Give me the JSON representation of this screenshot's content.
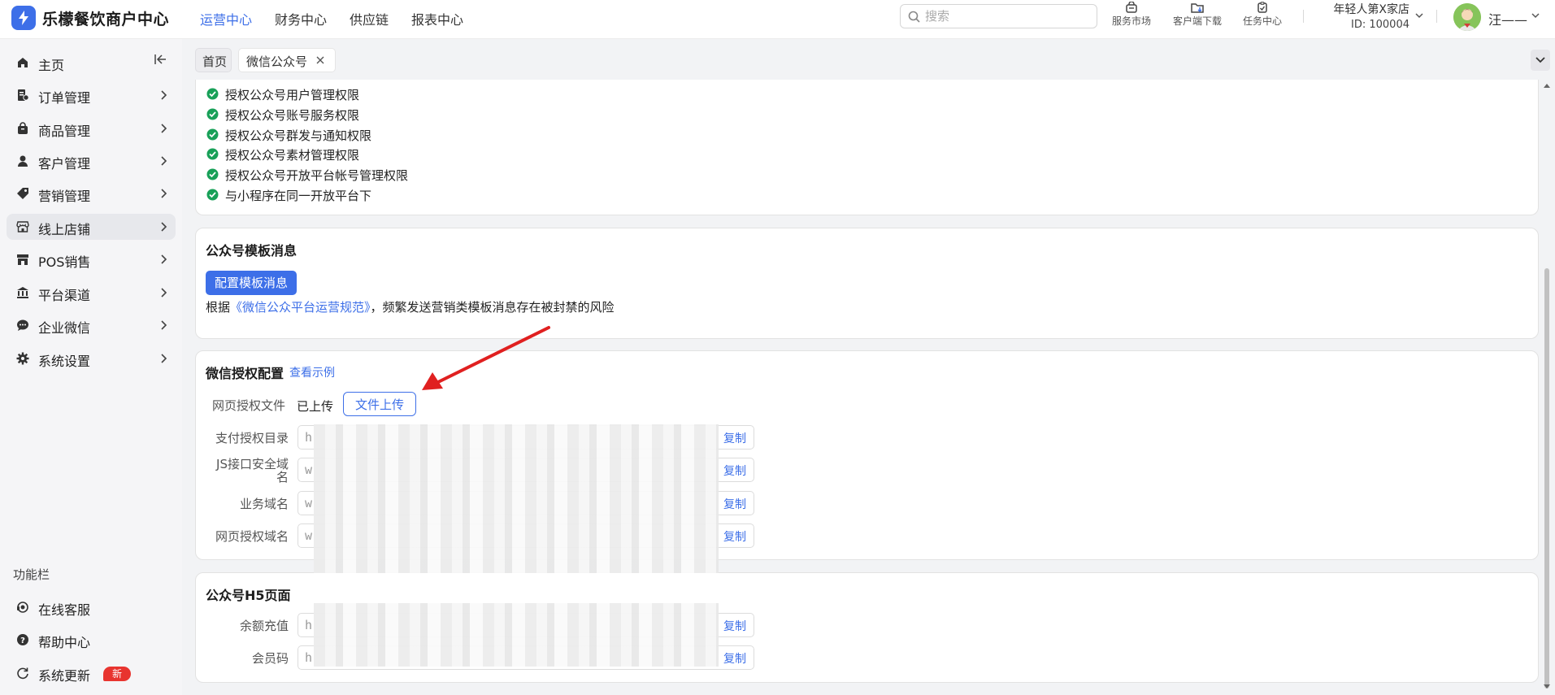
{
  "app": {
    "title": "乐檬餐饮商户中心"
  },
  "topnav": [
    {
      "label": "运营中心",
      "active": true
    },
    {
      "label": "财务中心",
      "active": false
    },
    {
      "label": "供应链",
      "active": false
    },
    {
      "label": "报表中心",
      "active": false
    }
  ],
  "search": {
    "placeholder": "搜索"
  },
  "tools": [
    {
      "label": "服务市场",
      "icon": "store-bag-icon"
    },
    {
      "label": "客户端下载",
      "icon": "download-folder-icon"
    },
    {
      "label": "任务中心",
      "icon": "clipboard-icon"
    }
  ],
  "store": {
    "name": "年轻人第X家店",
    "id": "ID: 100004"
  },
  "user": {
    "name": "汪——"
  },
  "sidebar": {
    "items": [
      {
        "label": "主页",
        "icon": "home-icon"
      },
      {
        "label": "订单管理",
        "icon": "order-icon"
      },
      {
        "label": "商品管理",
        "icon": "goods-icon"
      },
      {
        "label": "客户管理",
        "icon": "user-icon"
      },
      {
        "label": "营销管理",
        "icon": "tag-icon"
      },
      {
        "label": "线上店铺",
        "icon": "shop-icon",
        "active": true
      },
      {
        "label": "POS销售",
        "icon": "pos-store-icon"
      },
      {
        "label": "平台渠道",
        "icon": "bank-icon"
      },
      {
        "label": "企业微信",
        "icon": "chat-icon"
      },
      {
        "label": "系统设置",
        "icon": "gear-icon"
      }
    ],
    "function_title": "功能栏",
    "function_items": [
      {
        "label": "在线客服",
        "icon": "headset-icon"
      },
      {
        "label": "帮助中心",
        "icon": "help-icon"
      },
      {
        "label": "系统更新",
        "icon": "refresh-icon",
        "badge": "新"
      }
    ]
  },
  "tabs": [
    {
      "label": "首页"
    },
    {
      "label": "微信公众号",
      "active": true
    }
  ],
  "permissions": [
    "授权公众号用户管理权限",
    "授权公众号账号服务权限",
    "授权公众号群发与通知权限",
    "授权公众号素材管理权限",
    "授权公众号开放平台帐号管理权限",
    "与小程序在同一开放平台下"
  ],
  "template_msg": {
    "title": "公众号模板消息",
    "button": "配置模板消息",
    "rule_prefix": "根据",
    "rule_link": "《微信公众平台运营规范》",
    "rule_suffix": "，频繁发送营销类模板消息存在被封禁的风险"
  },
  "wx_auth": {
    "title": "微信授权配置",
    "example_link": "查看示例",
    "file_label": "网页授权文件",
    "file_status": "已上传",
    "upload_button": "文件上传",
    "fields": [
      {
        "label": "支付授权目录",
        "value": "h",
        "copy": "复制"
      },
      {
        "label": "JS接口安全域名",
        "value": "w",
        "copy": "复制"
      },
      {
        "label": "业务域名",
        "value": "w",
        "copy": "复制"
      },
      {
        "label": "网页授权域名",
        "value": "w",
        "copy": "复制"
      }
    ]
  },
  "h5": {
    "title": "公众号H5页面",
    "fields": [
      {
        "label": "余额充值",
        "value": "h",
        "copy": "复制"
      },
      {
        "label": "会员码",
        "value": "h",
        "copy": "复制"
      }
    ]
  },
  "colors": {
    "accent": "#3d6fe8",
    "success": "#18a058",
    "badge": "#e8342f",
    "arrow": "#e02020"
  }
}
